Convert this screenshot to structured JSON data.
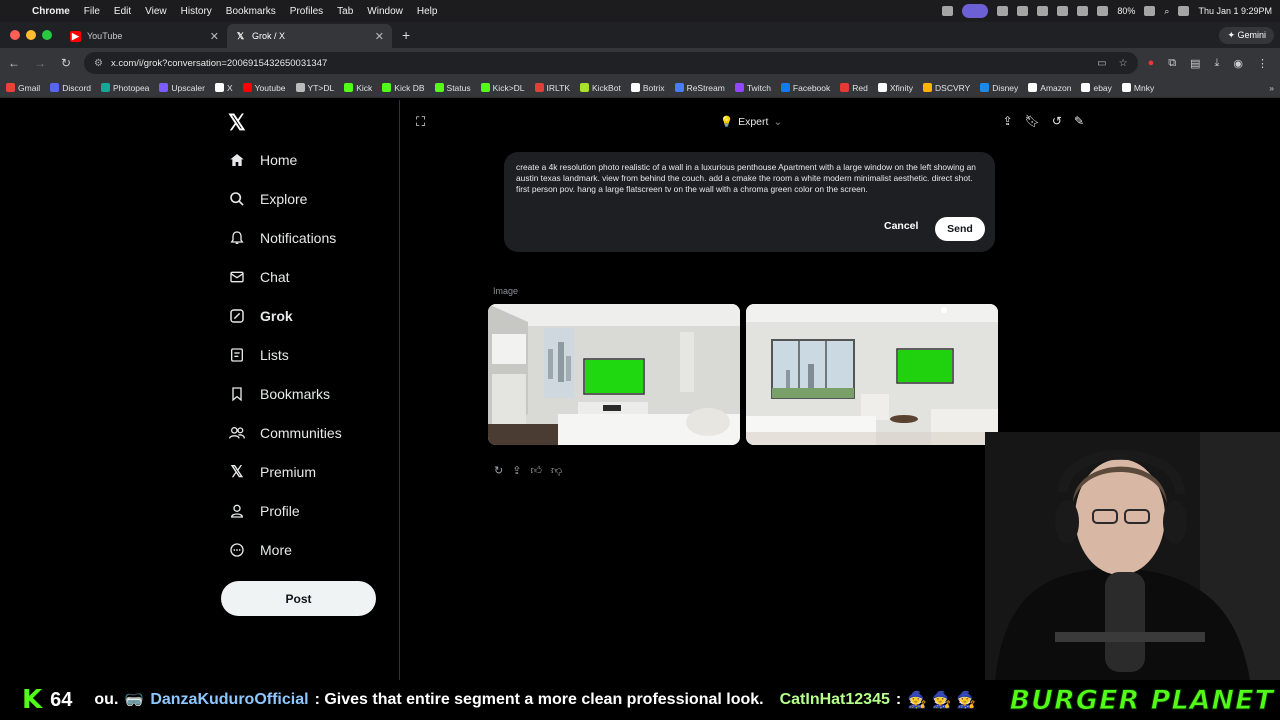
{
  "menubar": {
    "app": "Chrome",
    "items": [
      "File",
      "Edit",
      "View",
      "History",
      "Bookmarks",
      "Profiles",
      "Tab",
      "Window",
      "Help"
    ],
    "battery": "80%",
    "datetime": "Thu Jan 1  9:29PM"
  },
  "browser": {
    "tabs": [
      {
        "title": "YouTube",
        "favicon": "youtube-icon",
        "active": false
      },
      {
        "title": "Grok / X",
        "favicon": "x-icon",
        "active": true
      }
    ],
    "gemini_label": "Gemini",
    "url": "x.com/i/grok?conversation=2006915432650031347",
    "bookmarks": [
      {
        "label": "Gmail",
        "color": "#ea4335"
      },
      {
        "label": "Discord",
        "color": "#5865f2"
      },
      {
        "label": "Photopea",
        "color": "#18a497"
      },
      {
        "label": "Upscaler",
        "color": "#7b5cff"
      },
      {
        "label": "X",
        "color": "#ffffff"
      },
      {
        "label": "Youtube",
        "color": "#ff0000"
      },
      {
        "label": "YT>DL",
        "color": "#bbbbbb"
      },
      {
        "label": "Kick",
        "color": "#53fc18"
      },
      {
        "label": "Kick DB",
        "color": "#53fc18"
      },
      {
        "label": "Status",
        "color": "#53fc18"
      },
      {
        "label": "Kick>DL",
        "color": "#53fc18"
      },
      {
        "label": "IRLTK",
        "color": "#e0403a"
      },
      {
        "label": "KickBot",
        "color": "#a6e22e"
      },
      {
        "label": "Botrix",
        "color": "#ffffff"
      },
      {
        "label": "ReStream",
        "color": "#4a7bff"
      },
      {
        "label": "Twitch",
        "color": "#9146ff"
      },
      {
        "label": "Facebook",
        "color": "#1877f2"
      },
      {
        "label": "Red",
        "color": "#e53935"
      },
      {
        "label": "Xfinity",
        "color": "#ffffff"
      },
      {
        "label": "DSCVRY",
        "color": "#ffb300"
      },
      {
        "label": "Disney",
        "color": "#1e88e5"
      },
      {
        "label": "Amazon",
        "color": "#ffffff"
      },
      {
        "label": "ebay",
        "color": "#ffffff"
      },
      {
        "label": "Mnky",
        "color": "#ffffff"
      }
    ]
  },
  "sidebar": {
    "items": [
      {
        "label": "Home",
        "icon": "home-icon"
      },
      {
        "label": "Explore",
        "icon": "search-icon"
      },
      {
        "label": "Notifications",
        "icon": "bell-icon"
      },
      {
        "label": "Chat",
        "icon": "mail-icon"
      },
      {
        "label": "Grok",
        "icon": "grok-icon"
      },
      {
        "label": "Lists",
        "icon": "list-icon"
      },
      {
        "label": "Bookmarks",
        "icon": "bookmark-icon"
      },
      {
        "label": "Communities",
        "icon": "people-icon"
      },
      {
        "label": "Premium",
        "icon": "x-icon"
      },
      {
        "label": "Profile",
        "icon": "person-icon"
      },
      {
        "label": "More",
        "icon": "more-icon"
      }
    ],
    "post_label": "Post"
  },
  "grok": {
    "model": "Expert",
    "prompt": "create a 4k resolution photo realistic of a wall in a luxurious penthouse Apartment with a large window on the left showing an austin texas landmark.  view from behind the couch. add a cmake the room a white modern minimalist aesthetic. direct shot. first person pov. hang a large flatscreen tv on the wall with a chroma green color on the screen.",
    "cancel_label": "Cancel",
    "send_label": "Send",
    "image_label": "Image"
  },
  "stream": {
    "viewer_count": "64",
    "chat": [
      {
        "text": "ou.",
        "style": "white"
      },
      {
        "text": "DanzaKuduroOfficial",
        "style": "blue"
      },
      {
        "text": ": Gives that entire segment a more clean professional look.",
        "style": "white"
      },
      {
        "text": "CatInHat12345",
        "style": "green"
      },
      {
        "text": ":",
        "style": "white"
      }
    ],
    "banner": "BURGER PLANET"
  },
  "colors": {
    "kick_green": "#53fc18",
    "x_bg": "#000000",
    "prompt_bg": "#1d1f22"
  }
}
